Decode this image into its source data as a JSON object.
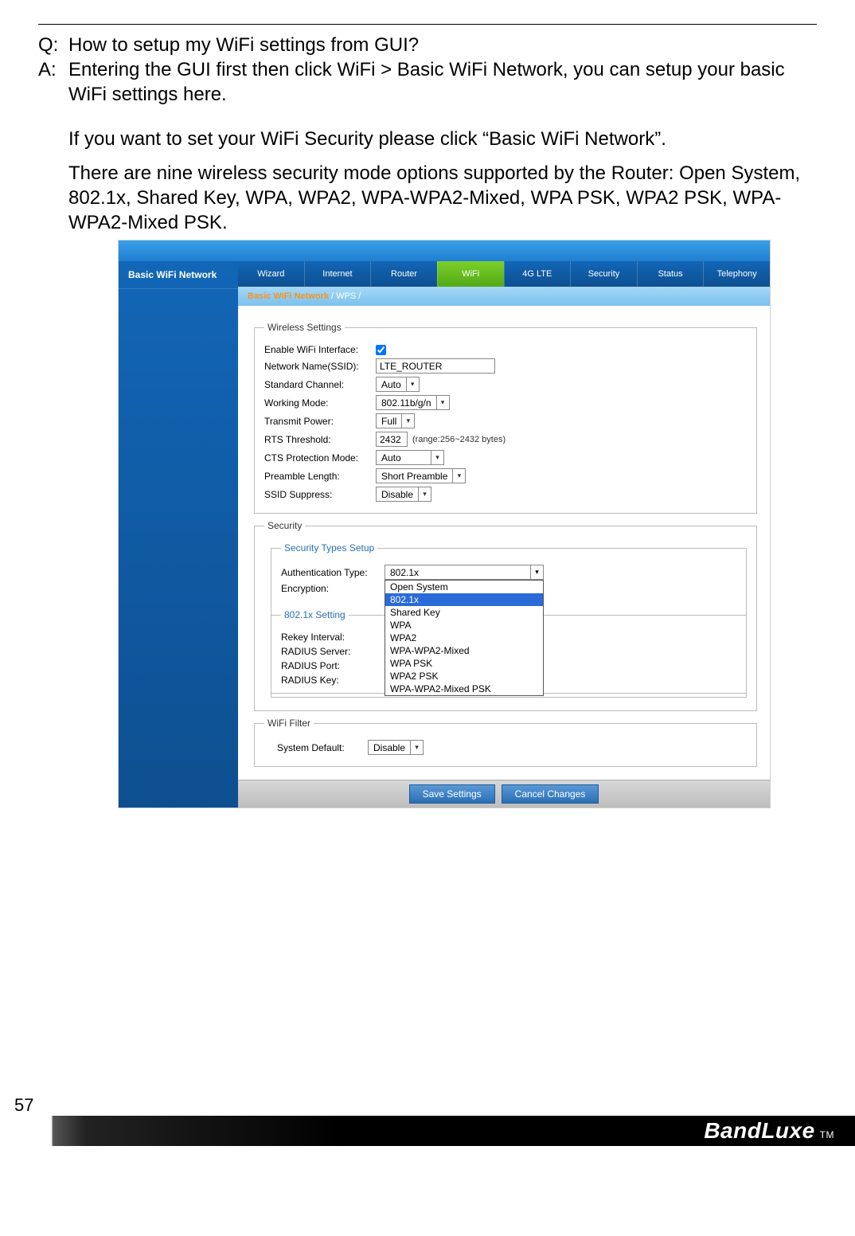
{
  "qa": {
    "q_label": "Q:",
    "a_label": "A:",
    "question": "How to setup my WiFi settings from GUI?",
    "answer1": "Entering the GUI first then click WiFi > Basic WiFi Network, you can setup your basic WiFi settings here.",
    "answer2": "If you want to set your WiFi Security please click “Basic WiFi Network”.",
    "answer3": "There are nine wireless security mode options supported by the Router: Open System, 802.1x, Shared Key, WPA, WPA2, WPA-WPA2-Mixed, WPA PSK, WPA2 PSK, WPA-WPA2-Mixed PSK."
  },
  "sidebar": {
    "item0": "Basic WiFi Network"
  },
  "tabs": {
    "t0": "Wizard",
    "t1": "Internet",
    "t2": "Router",
    "t3": "WiFi",
    "t4": "4G LTE",
    "t5": "Security",
    "t6": "Status",
    "t7": "Telephony"
  },
  "breadcrumb": {
    "active": "Basic WiFi Network",
    "sep": " /  ",
    "next": "WPS",
    "sep2": " /"
  },
  "wireless": {
    "legend": "Wireless Settings",
    "l_enable": "Enable WiFi Interface:",
    "l_ssid": "Network Name(SSID):",
    "v_ssid": "LTE_ROUTER",
    "l_channel": "Standard Channel:",
    "v_channel": "Auto",
    "l_mode": "Working Mode:",
    "v_mode": "802.11b/g/n",
    "l_tx": "Transmit Power:",
    "v_tx": "Full",
    "l_rts": "RTS Threshold:",
    "v_rts": "2432",
    "hint_rts": "(range:256~2432 bytes)",
    "l_cts": "CTS Protection Mode:",
    "v_cts": "Auto",
    "l_pre": "Preamble Length:",
    "v_pre": "Short Preamble",
    "l_sup": "SSID Suppress:",
    "v_sup": "Disable"
  },
  "security": {
    "legend": "Security",
    "types_legend": "Security Types Setup",
    "l_auth": "Authentication Type:",
    "v_auth": "802.1x",
    "l_enc": "Encryption:",
    "dd": {
      "o0": "Open System",
      "o1": "802.1x",
      "o2": "Shared Key",
      "o3": "WPA",
      "o4": "WPA2",
      "o5": "WPA-WPA2-Mixed",
      "o6": "WPA PSK",
      "o7": "WPA2 PSK",
      "o8": "WPA-WPA2-Mixed PSK"
    },
    "dot1x_legend": "802.1x Setting",
    "l_rekey": "Rekey Interval:",
    "l_srv": "RADIUS Server:",
    "l_port": "RADIUS Port:",
    "l_key": "RADIUS Key:"
  },
  "filter": {
    "legend": "WiFi Filter",
    "l_def": "System Default:",
    "v_def": "Disable"
  },
  "buttons": {
    "save": "Save Settings",
    "cancel": "Cancel Changes"
  },
  "footer": {
    "page": "57",
    "brand": "BandLuxe",
    "tm": "TM"
  }
}
